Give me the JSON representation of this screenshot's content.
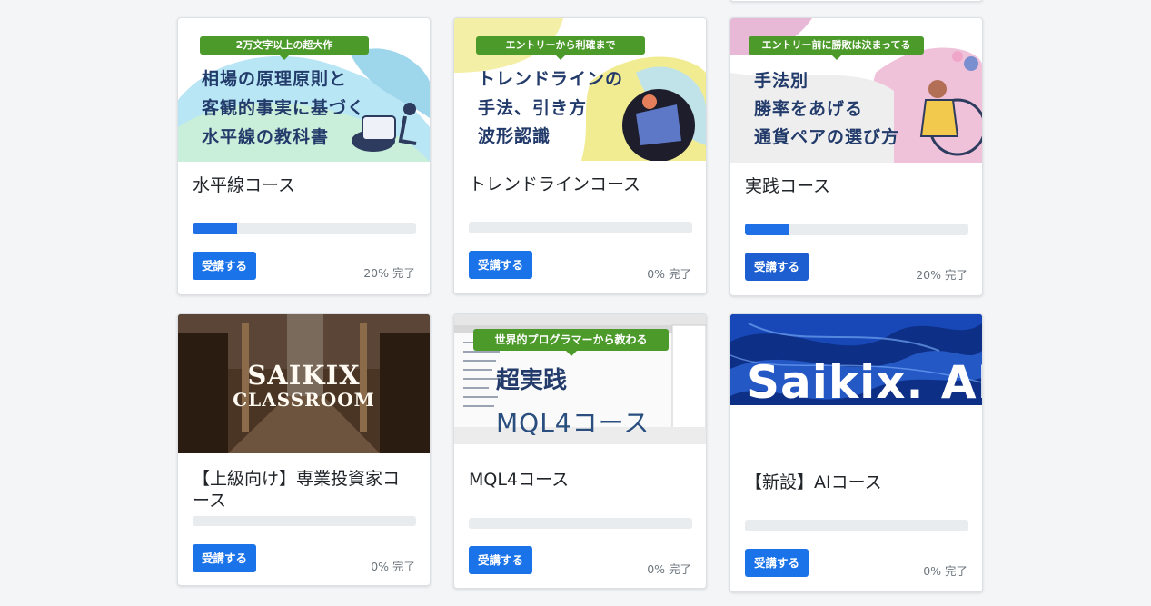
{
  "courses": [
    {
      "title": "水平線コース",
      "progress_fraction": 0.2,
      "status": "20% 完了",
      "button": "受講する",
      "thumb": {
        "ribbon": "2万文字以上の超大作",
        "lines": [
          "相場の原理原則と",
          "客観的事実に基づく",
          "水平線の教科書"
        ]
      }
    },
    {
      "title": "トレンドラインコース",
      "progress_fraction": 0.0,
      "status": "0% 完了",
      "button": "受講する",
      "thumb": {
        "ribbon": "エントリーから利確まで",
        "lines": [
          "トレンドラインの",
          "手法、引き方",
          "波形認識"
        ]
      }
    },
    {
      "title": "実践コース",
      "progress_fraction": 0.2,
      "status": "20% 完了",
      "button": "受講する",
      "thumb": {
        "ribbon": "エントリー前に勝敗は決まってる",
        "lines": [
          "手法別",
          "勝率をあげる",
          "通貨ペアの選び方"
        ]
      }
    },
    {
      "title": "【上級向け】専業投資家コース",
      "progress_fraction": 0.0,
      "status": "0% 完了",
      "button": "受講する",
      "thumb": {
        "lines": [
          "SAIKIX",
          "CLASSROOM"
        ]
      }
    },
    {
      "title": "MQL4コース",
      "progress_fraction": 0.0,
      "status": "0% 完了",
      "button": "受講する",
      "thumb": {
        "ribbon": "世界的プログラマーから教わる",
        "lines": [
          "超実践",
          "MQL4コース"
        ]
      }
    },
    {
      "title": "【新設】AIコース",
      "progress_fraction": 0.0,
      "status": "0% 完了",
      "button": "受講する",
      "thumb": {
        "lines": [
          "Saikix. AI"
        ]
      }
    }
  ],
  "colors": {
    "primary": "#1a73e8",
    "progress_fill": "#1f6fe6",
    "progress_track": "#e9ecef",
    "ribbon_green": "#4c9a2a",
    "page_bg": "#f4f5f7"
  }
}
